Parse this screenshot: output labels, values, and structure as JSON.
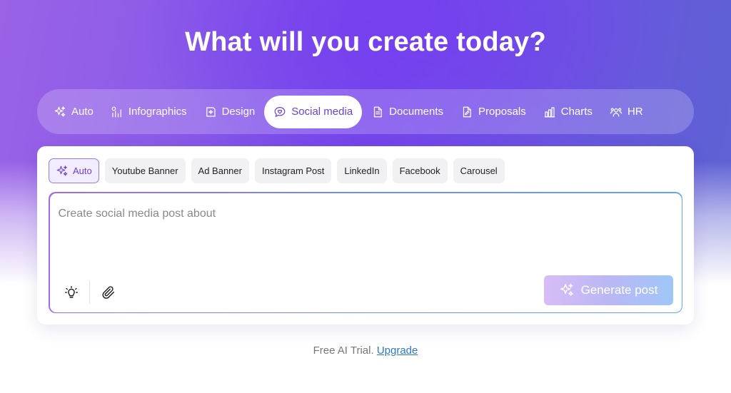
{
  "hero": {
    "title": "What will you create today?"
  },
  "categories": [
    {
      "label": "Auto",
      "icon": "sparkles-icon",
      "active": false
    },
    {
      "label": "Infographics",
      "icon": "infographic-icon",
      "active": false
    },
    {
      "label": "Design",
      "icon": "design-icon",
      "active": false
    },
    {
      "label": "Social media",
      "icon": "chat-heart-icon",
      "active": true
    },
    {
      "label": "Documents",
      "icon": "document-icon",
      "active": false
    },
    {
      "label": "Proposals",
      "icon": "proposal-icon",
      "active": false
    },
    {
      "label": "Charts",
      "icon": "bar-chart-icon",
      "active": false
    },
    {
      "label": "HR",
      "icon": "people-icon",
      "active": false
    }
  ],
  "post_types": [
    {
      "label": "Auto",
      "active": true
    },
    {
      "label": "Youtube Banner",
      "active": false
    },
    {
      "label": "Ad Banner",
      "active": false
    },
    {
      "label": "Instagram Post",
      "active": false
    },
    {
      "label": "LinkedIn",
      "active": false
    },
    {
      "label": "Facebook",
      "active": false
    },
    {
      "label": "Carousel",
      "active": false
    }
  ],
  "prompt": {
    "placeholder": "Create social media post about",
    "value": ""
  },
  "tools": {
    "ideas_icon": "lightbulb-icon",
    "attach_icon": "paperclip-icon"
  },
  "generate_button": {
    "label": "Generate post",
    "icon": "sparkles-icon"
  },
  "footer": {
    "text": "Free AI Trial.",
    "link": "Upgrade"
  },
  "colors": {
    "accent": "#6a3fd8",
    "link": "#2f77c5"
  }
}
